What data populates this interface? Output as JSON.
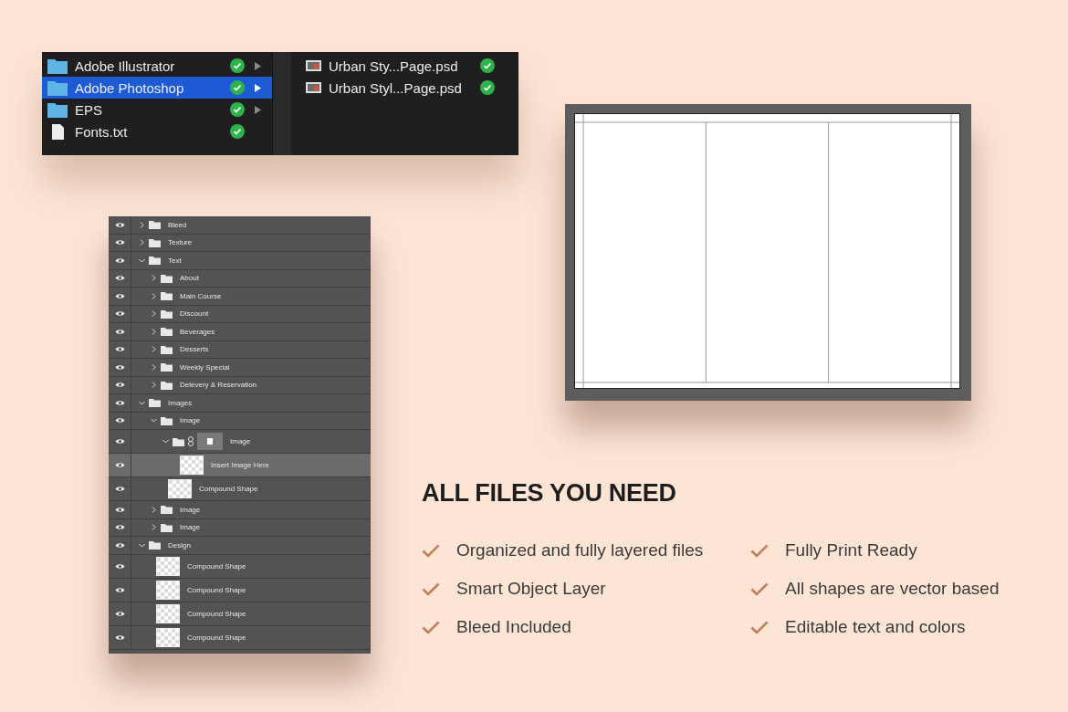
{
  "finder": {
    "folders": [
      {
        "name": "Adobe Illustrator",
        "kind": "folder",
        "selected": false,
        "has_children": true,
        "synced": true
      },
      {
        "name": "Adobe Photoshop",
        "kind": "folder",
        "selected": true,
        "has_children": true,
        "synced": true
      },
      {
        "name": "EPS",
        "kind": "folder",
        "selected": false,
        "has_children": true,
        "synced": true
      },
      {
        "name": "Fonts.txt",
        "kind": "file",
        "selected": false,
        "has_children": false,
        "synced": true
      }
    ],
    "files": [
      {
        "name": "Urban Sty...Page.psd",
        "synced": true
      },
      {
        "name": "Urban Styl...Page.psd",
        "synced": true
      }
    ]
  },
  "layers": [
    {
      "name": "Bleed",
      "kind": "folder",
      "expanded": false,
      "selected": false,
      "visible": true
    },
    {
      "name": "Texture",
      "kind": "folder",
      "expanded": false,
      "selected": false,
      "visible": true
    },
    {
      "name": "Text",
      "kind": "folder",
      "expanded": true,
      "selected": false,
      "visible": true,
      "children": [
        {
          "name": "About",
          "kind": "folder",
          "expanded": false,
          "selected": false,
          "visible": true
        },
        {
          "name": "Main Course",
          "kind": "folder",
          "expanded": false,
          "selected": false,
          "visible": true
        },
        {
          "name": "Discount",
          "kind": "folder",
          "expanded": false,
          "selected": false,
          "visible": true
        },
        {
          "name": "Beverages",
          "kind": "folder",
          "expanded": false,
          "selected": false,
          "visible": true
        },
        {
          "name": "Desserts",
          "kind": "folder",
          "expanded": false,
          "selected": false,
          "visible": true
        },
        {
          "name": "Weekly Special",
          "kind": "folder",
          "expanded": false,
          "selected": false,
          "visible": true
        },
        {
          "name": "Delevery & Reservation",
          "kind": "folder",
          "expanded": false,
          "selected": false,
          "visible": true
        }
      ]
    },
    {
      "name": "Images",
      "kind": "folder",
      "expanded": true,
      "selected": false,
      "visible": true,
      "children": [
        {
          "name": "Image",
          "kind": "folder",
          "expanded": true,
          "selected": false,
          "visible": true,
          "children": [
            {
              "name": "Image",
              "kind": "masked-folder",
              "expanded": true,
              "selected": false,
              "visible": true,
              "children": [
                {
                  "name": "Insert Image Here",
                  "kind": "smart-object",
                  "selected": true,
                  "visible": true
                }
              ]
            },
            {
              "name": "Compound Shape",
              "kind": "shape",
              "selected": false,
              "visible": true
            }
          ]
        },
        {
          "name": "Image",
          "kind": "folder",
          "expanded": false,
          "selected": false,
          "visible": true
        },
        {
          "name": "Image",
          "kind": "folder",
          "expanded": false,
          "selected": false,
          "visible": true
        }
      ]
    },
    {
      "name": "Design",
      "kind": "folder",
      "expanded": true,
      "selected": false,
      "visible": true,
      "children": [
        {
          "name": "Compound Shape",
          "kind": "shape",
          "selected": false,
          "visible": true
        },
        {
          "name": "Compound Shape",
          "kind": "shape",
          "selected": false,
          "visible": true
        },
        {
          "name": "Compound Shape",
          "kind": "shape",
          "selected": false,
          "visible": true
        },
        {
          "name": "Compound Shape",
          "kind": "shape",
          "selected": false,
          "visible": true
        }
      ]
    }
  ],
  "features": {
    "heading": "ALL FILES YOU NEED",
    "items": [
      "Organized and fully layered files",
      "Fully Print Ready",
      "Smart Object Layer",
      "All shapes are vector based",
      "Bleed Included",
      "Editable text and colors"
    ]
  }
}
